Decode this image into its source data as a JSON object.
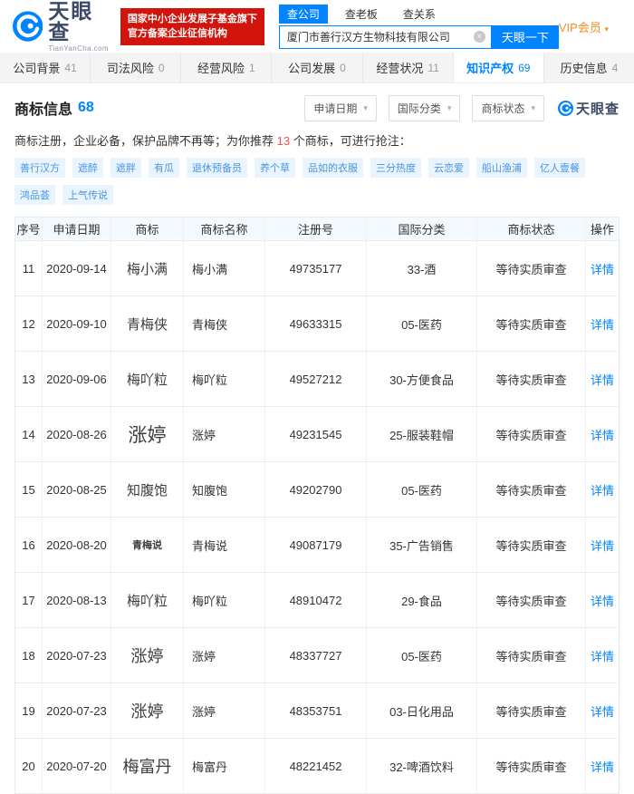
{
  "colors": {
    "accent_blue": "#0084ff",
    "badge_red": "#d2150c",
    "vip_orange": "#f08f1f",
    "tag_blue": "#4795e6",
    "highlight_red": "#f3524f",
    "logo_navy": "#3b4a66"
  },
  "header": {
    "logo_name": "天眼查",
    "logo_domain": "TianYanCha.com",
    "badge_line1": "国家中小企业发展子基金旗下",
    "badge_line2": "官方备案企业征信机构",
    "search_tabs": [
      {
        "label": "查公司",
        "active": true
      },
      {
        "label": "查老板",
        "active": false
      },
      {
        "label": "查关系",
        "active": false
      }
    ],
    "search_value": "厦门市善行汉方生物科技有限公司",
    "clear_icon": "×",
    "search_button": "天眼一下",
    "vip_label": "VIP会员",
    "vip_caret": "▾"
  },
  "nav": {
    "tabs": [
      {
        "label": "公司背景",
        "count": "41",
        "active": false
      },
      {
        "label": "司法风险",
        "count": "0",
        "active": false
      },
      {
        "label": "经营风险",
        "count": "1",
        "active": false
      },
      {
        "label": "公司发展",
        "count": "0",
        "active": false
      },
      {
        "label": "经营状况",
        "count": "11",
        "active": false
      },
      {
        "label": "知识产权",
        "count": "69",
        "active": true
      },
      {
        "label": "历史信息",
        "count": "4",
        "active": false
      }
    ]
  },
  "section": {
    "title": "商标信息",
    "count": "68",
    "filters": [
      "申请日期",
      "国际分类",
      "商标状态"
    ],
    "filter_caret": "▾",
    "watermark": "天眼查"
  },
  "promo": {
    "text_before": "商标注册，企业必备，保护品牌不再等；为你推荐 ",
    "highlight": "13",
    "text_after": " 个商标，可进行抢注：",
    "tags": [
      "善行汉方",
      "遮醉",
      "遮胖",
      "有瓜",
      "退休预备员",
      "养个草",
      "品如的衣服",
      "三分热度",
      "云恋爱",
      "船山渔浦",
      "亿人壹餐",
      "鸿品荟",
      "上气传说"
    ]
  },
  "table": {
    "columns": [
      "序号",
      "申请日期",
      "商标",
      "商标名称",
      "注册号",
      "国际分类",
      "商标状态",
      "操作"
    ],
    "detail_label": "详情",
    "rows": [
      {
        "seq": "11",
        "date": "2020-09-14",
        "mark": "梅小满",
        "mark_scale": "md",
        "name": "梅小满",
        "reg_no": "49735177",
        "intl_class": "33-酒",
        "status": "等待实质审查"
      },
      {
        "seq": "12",
        "date": "2020-09-10",
        "mark": "青梅侠",
        "mark_scale": "md",
        "name": "青梅侠",
        "reg_no": "49633315",
        "intl_class": "05-医药",
        "status": "等待实质审查"
      },
      {
        "seq": "13",
        "date": "2020-09-06",
        "mark": "梅吖粒",
        "mark_scale": "md",
        "name": "梅吖粒",
        "reg_no": "49527212",
        "intl_class": "30-方便食品",
        "status": "等待实质审查"
      },
      {
        "seq": "14",
        "date": "2020-08-26",
        "mark": "涨婷",
        "mark_scale": "xl",
        "name": "涨婷",
        "reg_no": "49231545",
        "intl_class": "25-服装鞋帽",
        "status": "等待实质审查"
      },
      {
        "seq": "15",
        "date": "2020-08-25",
        "mark": "知腹饱",
        "mark_scale": "md",
        "name": "知腹饱",
        "reg_no": "49202790",
        "intl_class": "05-医药",
        "status": "等待实质审查"
      },
      {
        "seq": "16",
        "date": "2020-08-20",
        "mark": "青梅说",
        "mark_scale": "sm",
        "name": "青梅说",
        "reg_no": "49087179",
        "intl_class": "35-广告销售",
        "status": "等待实质审查"
      },
      {
        "seq": "17",
        "date": "2020-08-13",
        "mark": "梅吖粒",
        "mark_scale": "md",
        "name": "梅吖粒",
        "reg_no": "48910472",
        "intl_class": "29-食品",
        "status": "等待实质审查"
      },
      {
        "seq": "18",
        "date": "2020-07-23",
        "mark": "涨婷",
        "mark_scale": "lg",
        "name": "涨婷",
        "reg_no": "48337727",
        "intl_class": "05-医药",
        "status": "等待实质审查"
      },
      {
        "seq": "19",
        "date": "2020-07-23",
        "mark": "涨婷",
        "mark_scale": "lg",
        "name": "涨婷",
        "reg_no": "48353751",
        "intl_class": "03-日化用品",
        "status": "等待实质审查"
      },
      {
        "seq": "20",
        "date": "2020-07-20",
        "mark": "梅富丹",
        "mark_scale": "lg",
        "name": "梅富丹",
        "reg_no": "48221452",
        "intl_class": "32-啤酒饮料",
        "status": "等待实质审查"
      }
    ]
  }
}
